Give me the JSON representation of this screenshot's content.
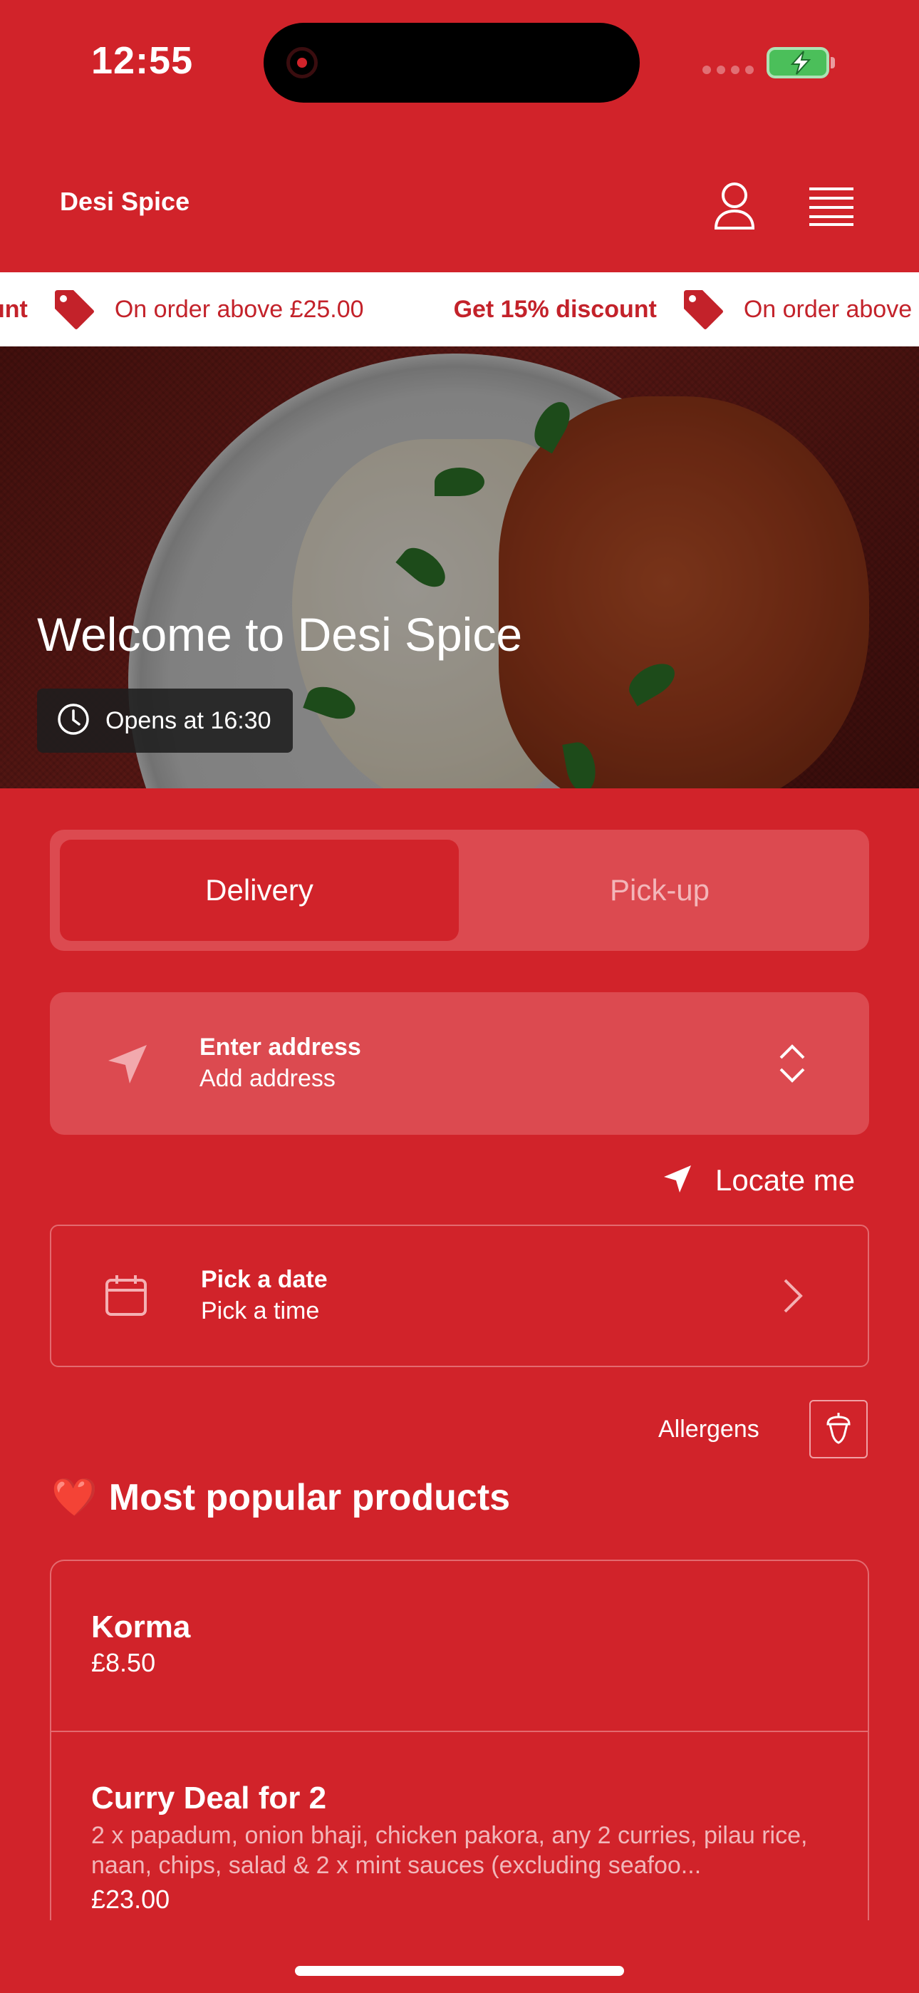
{
  "status_bar": {
    "time": "12:55"
  },
  "header": {
    "brand": "Desi Spice",
    "account_icon": "person-icon",
    "menu_icon": "hamburger-menu-icon"
  },
  "promo": {
    "items": [
      {
        "bold": "Get 15% discount",
        "text": "On order above £25.00"
      },
      {
        "bold": "Get 15% discount",
        "text": "On order above £25.00"
      }
    ],
    "visible_leading_fragment": "unt",
    "icon": "tag-icon"
  },
  "hero": {
    "title": "Welcome to Desi Spice",
    "opens": "Opens at 16:30",
    "opens_icon": "clock-icon"
  },
  "mode_toggle": {
    "delivery": "Delivery",
    "pickup": "Pick-up",
    "selected": "Delivery"
  },
  "address": {
    "title": "Enter address",
    "subtitle": "Add address",
    "icon": "location-arrow-icon",
    "chevrons_icon": "chevron-up-down-icon"
  },
  "locate_me": {
    "label": "Locate me",
    "icon": "location-arrow-icon"
  },
  "schedule": {
    "date": "Pick a date",
    "time": "Pick a time",
    "icon": "calendar-icon",
    "chevron_icon": "chevron-right-icon"
  },
  "allergens": {
    "label": "Allergens",
    "icon": "acorn-icon"
  },
  "popular": {
    "heart": "❤️",
    "title": "Most popular products",
    "products": [
      {
        "name": "Korma",
        "description": "",
        "price": "£8.50"
      },
      {
        "name": "Curry Deal for 2",
        "description": "2 x papadum, onion bhaji, chicken pakora, any 2 curries, pilau rice, naan, chips, salad & 2 x mint sauces (excluding seafoo...",
        "price": "£23.00"
      }
    ]
  },
  "colors": {
    "brand_red": "#d1232a",
    "panel_red": "#dc4a50",
    "white": "#ffffff"
  }
}
